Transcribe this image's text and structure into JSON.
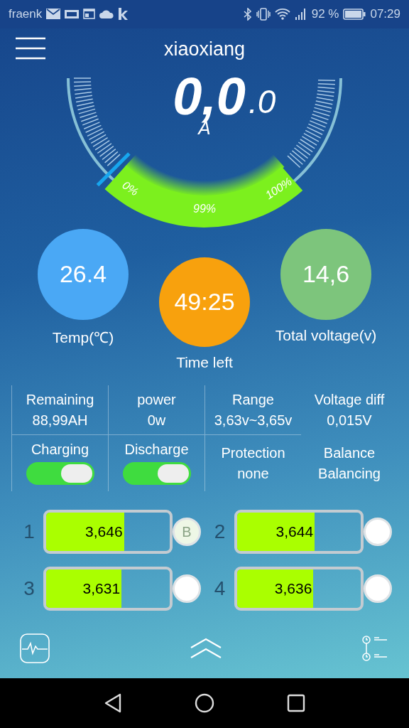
{
  "status_bar": {
    "carrier": "fraenk",
    "battery": "92 %",
    "time": "07:29"
  },
  "header": {
    "title": "xiaoxiang"
  },
  "gauge": {
    "current": "0,0",
    "current_decimal": ".0",
    "unit": "A",
    "min_label": "0%",
    "value_label": "99%",
    "max_label": "100%"
  },
  "metrics": [
    {
      "value": "26.4",
      "label": "Temp(℃)",
      "color": "#4aa8f5"
    },
    {
      "value": "49:25",
      "label": "Time left",
      "color": "#f8a10d"
    },
    {
      "value": "14,6",
      "label": "Total voltage(v)",
      "color": "#7dc57c"
    }
  ],
  "stats": [
    {
      "kind": "text",
      "label": "Remaining",
      "value": "88,99AH"
    },
    {
      "kind": "text",
      "label": "power",
      "value": "0w"
    },
    {
      "kind": "text",
      "label": "Range",
      "value": "3,63v~3,65v"
    },
    {
      "kind": "text",
      "label": "Voltage diff",
      "value": "0,015V"
    },
    {
      "kind": "switch",
      "label": "Charging",
      "on": true
    },
    {
      "kind": "switch",
      "label": "Discharge",
      "on": true
    },
    {
      "kind": "text",
      "label": "Protection",
      "value": "none"
    },
    {
      "kind": "text",
      "label": "Balance",
      "value": "Balancing"
    }
  ],
  "cells": [
    {
      "index": "1",
      "voltage": "3,646",
      "level": 0.63,
      "balancing": true,
      "indicator": "B"
    },
    {
      "index": "2",
      "voltage": "3,644",
      "level": 0.63,
      "balancing": false
    },
    {
      "index": "3",
      "voltage": "3,631",
      "level": 0.61,
      "balancing": false
    },
    {
      "index": "4",
      "voltage": "3,636",
      "level": 0.62,
      "balancing": false
    }
  ]
}
